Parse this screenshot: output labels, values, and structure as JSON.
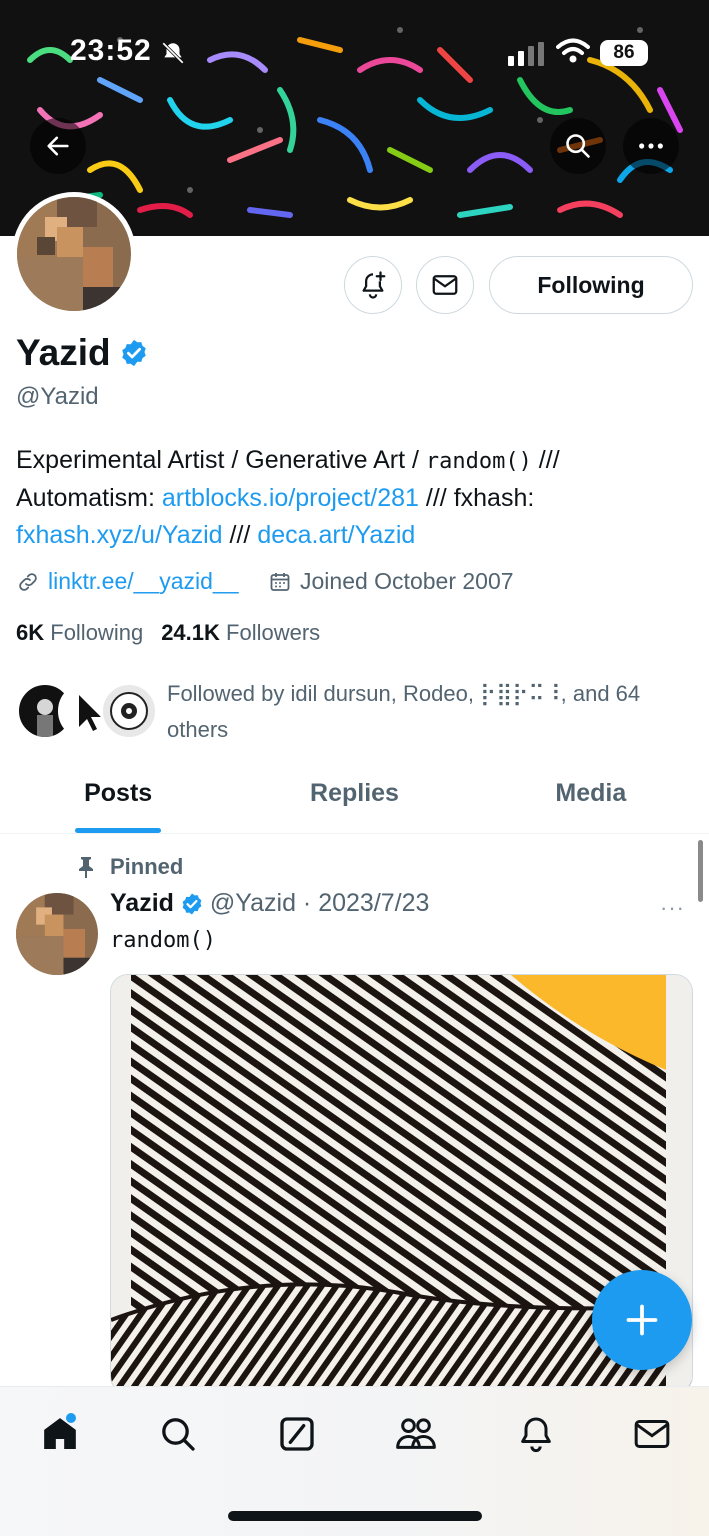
{
  "status_bar": {
    "time": "23:52",
    "battery": "86"
  },
  "profile": {
    "name": "Yazid",
    "handle": "@Yazid",
    "bio": {
      "part1": "Experimental Artist / Generative Art / ",
      "code": "random()",
      "part2": " ///",
      "part3": "Automatism: ",
      "link1": "artblocks.io/project/281",
      "part4": " /// fxhash: ",
      "link2": "fxhash.xyz/u/Yazid",
      "part5": " /// ",
      "link3": "deca.art/Yazid"
    },
    "website": "linktr.ee/__yazid__",
    "joined": "Joined October 2007",
    "following_count": "6K",
    "following_label": "Following",
    "followers_count": "24.1K",
    "followers_label": "Followers",
    "followed_by": "Followed by idil dursun, Rodeo, ⡗⣿⡗⠭⠸, and 64 others"
  },
  "actions": {
    "following_button": "Following"
  },
  "tabs": [
    "Posts",
    "Replies",
    "Media"
  ],
  "post": {
    "pinned_label": "Pinned",
    "name": "Yazid",
    "handle_date": "@Yazid · 2023/7/23",
    "text": "random()",
    "more": "···"
  },
  "colors": {
    "accent": "#1d9bf0",
    "text": "#0f1419",
    "secondary": "#536471"
  }
}
